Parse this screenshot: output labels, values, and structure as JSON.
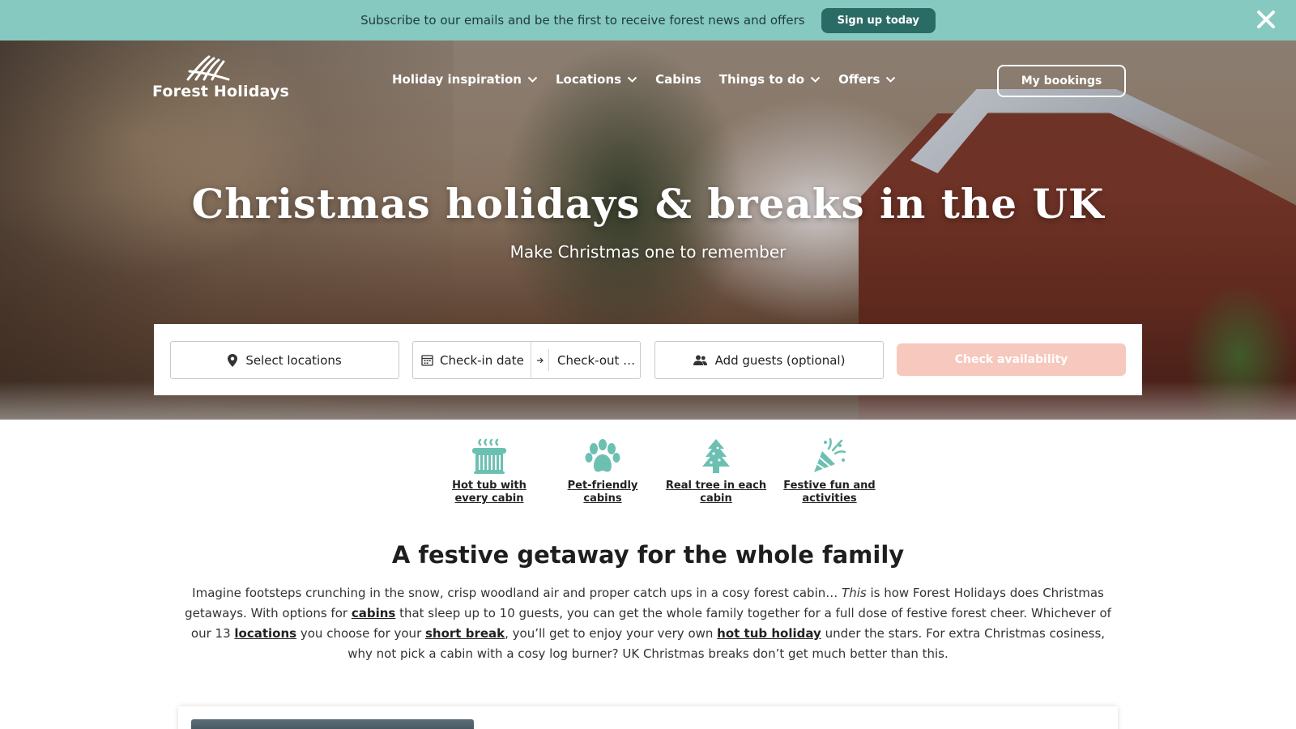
{
  "promo": {
    "text": "Subscribe to our emails and be the first to receive forest news and offers",
    "button": "Sign up today",
    "close_icon": "close-icon"
  },
  "brand": {
    "name": "Forest Holidays",
    "accent": "#2b6b66",
    "banner_color": "#86c9c1",
    "cta_color": "#f7c8bd"
  },
  "nav": {
    "items": [
      {
        "label": "Holiday inspiration",
        "dropdown": true
      },
      {
        "label": "Locations",
        "dropdown": true
      },
      {
        "label": "Cabins",
        "dropdown": false
      },
      {
        "label": "Things to do",
        "dropdown": true
      },
      {
        "label": "Offers",
        "dropdown": true
      }
    ],
    "bookings": "My bookings"
  },
  "hero": {
    "title": "Christmas holidays & breaks in the UK",
    "subtitle": "Make Christmas one to remember"
  },
  "search": {
    "locations": "Select locations",
    "checkin": "Check-in date",
    "checkout": "Check-out date",
    "guests": "Add guests (optional)",
    "button": "Check availability"
  },
  "features": [
    {
      "icon": "hot-tub-icon",
      "label": "Hot tub with every cabin"
    },
    {
      "icon": "paw-icon",
      "label": "Pet-friendly cabins"
    },
    {
      "icon": "christmas-tree-icon",
      "label": "Real tree in each cabin"
    },
    {
      "icon": "party-popper-icon",
      "label": "Festive fun and activities"
    }
  ],
  "content": {
    "heading": "A festive getaway for the whole family",
    "p1": "Imagine footsteps crunching in the snow, crisp woodland air and proper catch ups in a cosy forest cabin… ",
    "p1_em": "This",
    "p2": " is how Forest Holidays does Christmas getaways. With options for ",
    "link_cabins": "cabins",
    "p3": " that sleep up to 10 guests, you can get the whole family together for a full dose of festive forest cheer. Whichever of our 13 ",
    "link_locations": "locations",
    "p4": " you choose for your ",
    "link_short_break": "short break",
    "p5": ", you’ll get to enjoy your very own ",
    "link_hot_tub": "hot tub holiday",
    "p6": " under the stars. For extra Christmas cosiness, why not pick a cabin with a cosy log burner? UK Christmas breaks don’t get much better than this."
  }
}
